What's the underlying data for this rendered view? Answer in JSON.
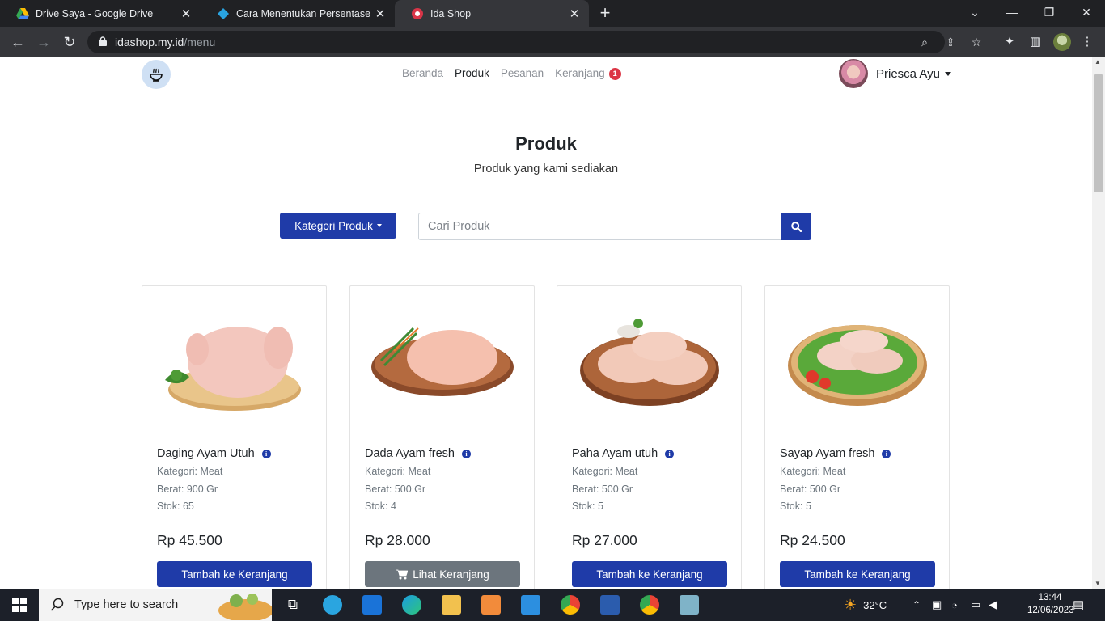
{
  "browser": {
    "tabs": [
      {
        "title": "Drive Saya - Google Drive",
        "icon": "google-drive-icon"
      },
      {
        "title": "Cara Menentukan Persentase dar",
        "icon": "blue-diamond-icon"
      },
      {
        "title": "Ida Shop",
        "icon": "ida-shop-icon"
      }
    ],
    "url_host": "idashop.my.id",
    "url_path": "/menu"
  },
  "site": {
    "nav": [
      {
        "label": "Beranda"
      },
      {
        "label": "Produk"
      },
      {
        "label": "Pesanan"
      },
      {
        "label": "Keranjang"
      }
    ],
    "cart_count": "1",
    "user_name": "Priesca Ayu"
  },
  "main": {
    "title": "Produk",
    "subtitle": "Produk yang kami sediakan",
    "category_button": "Kategori Produk",
    "search_placeholder": "Cari Produk"
  },
  "products": [
    {
      "name": "Daging Ayam Utuh",
      "category": "Kategori: Meat",
      "weight": "Berat: 900 Gr",
      "stock": "Stok: 65",
      "price": "Rp 45.500",
      "button": "Tambah ke Keranjang"
    },
    {
      "name": "Dada Ayam fresh",
      "category": "Kategori: Meat",
      "weight": "Berat: 500 Gr",
      "stock": "Stok: 4",
      "price": "Rp 28.000",
      "button": "Lihat Keranjang"
    },
    {
      "name": "Paha Ayam utuh",
      "category": "Kategori: Meat",
      "weight": "Berat: 500 Gr",
      "stock": "Stok: 5",
      "price": "Rp 27.000",
      "button": "Tambah ke Keranjang"
    },
    {
      "name": "Sayap Ayam fresh",
      "category": "Kategori: Meat",
      "weight": "Berat: 500 Gr",
      "stock": "Stok: 5",
      "price": "Rp 24.500",
      "button": "Tambah ke Keranjang"
    }
  ],
  "taskbar": {
    "search_placeholder": "Type here to search",
    "weather": "32°C",
    "time": "13:44",
    "date": "12/06/2023"
  },
  "colors": {
    "primary": "#1f3ba8",
    "secondary": "#6c757d",
    "badge": "#dc3545"
  }
}
